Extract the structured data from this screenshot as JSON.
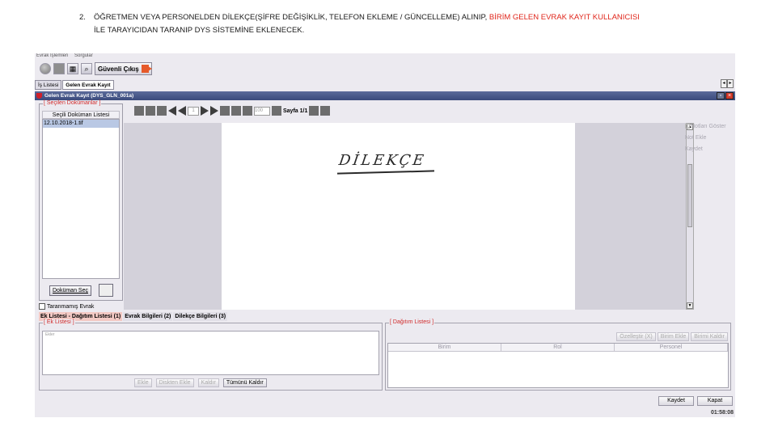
{
  "instruction": {
    "number": "2.",
    "text_black": "ÖĞRETMEN VEYA PERSONELDEN DİLEKÇE(ŞİFRE DEĞİŞİKLİK, TELEFON EKLEME / GÜNCELLEME) ALINIP, ",
    "text_red": "BİRİM GELEN EVRAK KAYIT KULLANICISI",
    "text_line2": "İLE TARAYICIDAN TARANIP DYS SİSTEMİNE EKLENECEK."
  },
  "app": {
    "menu": [
      "Evrak İşlemleri",
      "Sorgular"
    ],
    "logout_label": "Güvenli Çıkış",
    "top_tabs": [
      "İş Listesi",
      "Gelen Evrak Kayıt"
    ],
    "window_title": "Gelen Evrak Kayıt (DYS_GLN_001a)",
    "selected_docs_legend": "[ Seçilen Dokümanlar ]",
    "selected_docs_header": "Seçili Doküman Listesi",
    "selected_docs": [
      "12.10.2018-1.tif"
    ],
    "select_doc_button": "Doküman Seç",
    "unscanned_label": "Taranmamış Evrak",
    "viewer": {
      "page_input": "1",
      "zoom": "100",
      "page_label": "Sayfa 1/1",
      "handwriting": "DİLEKÇE"
    },
    "notes": [
      "Notları Göster",
      "Not Ekle",
      "Kaydet"
    ],
    "bottom_tabs": [
      "Ek Listesi - Dağıtım Listesi (1)",
      "Evrak Bilgileri (2)",
      "Dilekçe Bilgileri (3)"
    ],
    "ek_legend": "[ Ek Listesi ]",
    "ek_root": "Ekler",
    "ek_buttons": [
      "Ekle",
      "Diskten Ekle",
      "Kaldır",
      "Tümünü Kaldır"
    ],
    "dag_legend": "[ Dağıtım Listesi ]",
    "dag_buttons": [
      "Özelleştir (X)",
      "Birim Ekle",
      "Birimi Kaldır"
    ],
    "dag_columns": [
      "Birim",
      "Rol",
      "Personel"
    ],
    "save_button": "Kaydet",
    "close_button": "Kapat",
    "clock": "01:58:08"
  }
}
